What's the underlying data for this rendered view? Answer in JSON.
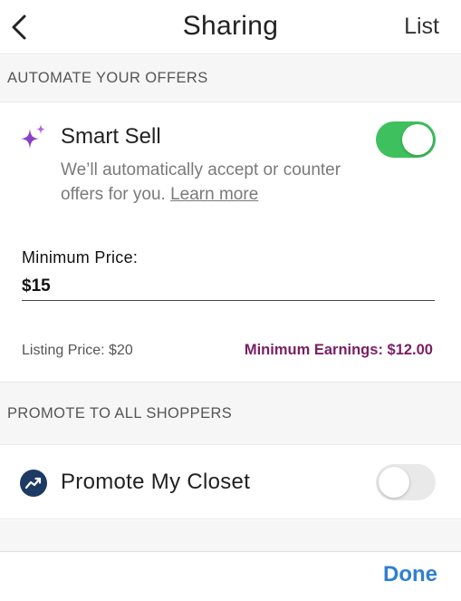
{
  "header": {
    "title": "Sharing",
    "right_action": "List",
    "back_icon": "chevron-left-icon"
  },
  "automate_section": {
    "header": "AUTOMATE YOUR OFFERS",
    "smart_sell": {
      "icon": "sparkle-icon",
      "title": "Smart Sell",
      "description": "We’ll automatically accept or counter offers for you.",
      "link": "Learn more",
      "enabled": true
    },
    "minimum_price_label": "Minimum Price:",
    "minimum_price_value": "$15",
    "listing_price": "Listing Price: $20",
    "minimum_earnings": "Minimum Earnings: $12.00"
  },
  "promote_section": {
    "header": "PROMOTE TO ALL SHOPPERS",
    "promote_closet": {
      "icon": "trending-up-icon",
      "label": "Promote My Closet",
      "enabled": false
    }
  },
  "footer": {
    "done_label": "Done"
  },
  "colors": {
    "toggle_on": "#3dc05d",
    "toggle_off": "#e9e9e9",
    "earnings": "#7a1f63",
    "done": "#2f7fd1",
    "promote_icon_bg": "#1d3a63",
    "sparkle": "#8a3fc9"
  }
}
